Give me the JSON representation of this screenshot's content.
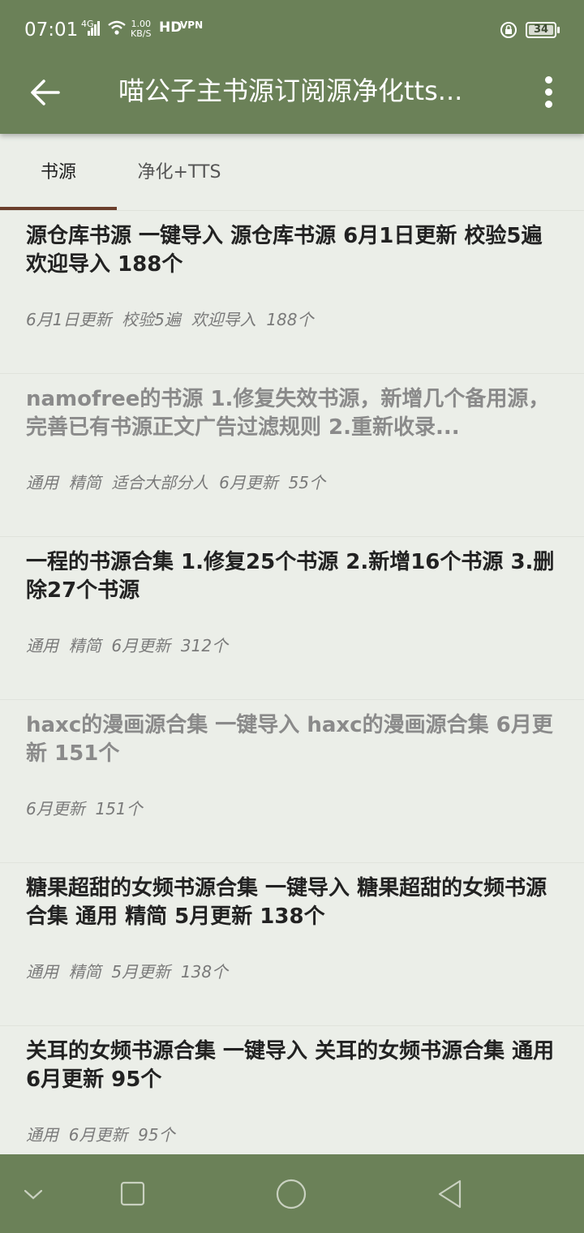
{
  "status_bar": {
    "time": "07:01",
    "network": "4G",
    "speed_value": "1.00",
    "speed_unit": "KB/S",
    "hd": "HD",
    "vpn": "VPN",
    "battery": "34"
  },
  "app_bar": {
    "title": "喵公子主书源订阅源净化tts..."
  },
  "tabs": [
    {
      "label": "书源",
      "active": true
    },
    {
      "label": "净化+TTS",
      "active": false
    }
  ],
  "items": [
    {
      "name": "源仓库书源  一键导入    源仓库书源 6月1日更新 校验5遍 欢迎导入 188个",
      "tags": "6月1日更新  校验5遍  欢迎导入  188个"
    },
    {
      "name": "namofree的书源  1.修复失效书源，新增几个备用源，完善已有书源正文广告过滤规则  2.重新收录...",
      "tags": "通用  精简  适合大部分人  6月更新  55个"
    },
    {
      "name": "一程的书源合集  1.修复25个书源  2.新增16个书源 3.删除27个书源",
      "tags": "通用  精简  6月更新  312个"
    },
    {
      "name": "haxc的漫画源合集  一键导入    haxc的漫画源合集 6月更新 151个",
      "tags": "6月更新  151个"
    },
    {
      "name": "糖果超甜的女频书源合集  一键导入    糖果超甜的女频书源合集 通用 精简 5月更新 138个",
      "tags": "通用  精简  5月更新  138个"
    },
    {
      "name": "关耳的女频书源合集  一键导入    关耳的女频书源合集 通用 6月更新 95个",
      "tags": "通用  6月更新  95个"
    }
  ],
  "colors": {
    "primary": "#6b8158",
    "background": "#ebeee8",
    "tab_indicator": "#6b3f2c"
  }
}
